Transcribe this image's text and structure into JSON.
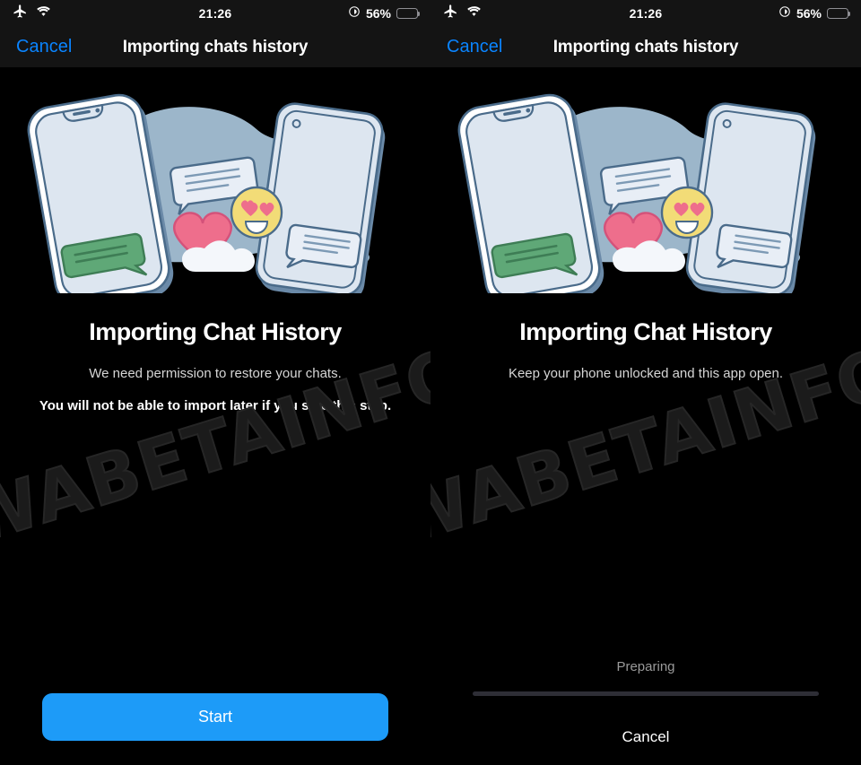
{
  "status_bar": {
    "airplane_icon": "airplane-icon",
    "wifi_icon": "wifi-icon",
    "time": "21:26",
    "focus_icon": "location-focus-icon",
    "battery_percent": "56%",
    "battery_level": 56
  },
  "nav": {
    "cancel_label": "Cancel",
    "title": "Importing chats history"
  },
  "watermark": {
    "text": "WABETAINFO"
  },
  "illustration": {
    "name": "chat-history-transfer-illustration",
    "blob_color": "#9cb6ca",
    "phone_body_color": "#dde6f0",
    "phone_outline_color": "#4a6b8a",
    "phone_shadow_color": "#6b8aa8",
    "heart_color": "#ee6e8c",
    "emoji_color": "#f2dc77",
    "cloud_color": "#f4f7fb",
    "green_bubble_color": "#5fa877",
    "light_bubble_color": "#e8eef6"
  },
  "panels": [
    {
      "id": "permission-screen",
      "heading": "Importing Chat History",
      "subtitle": "We need permission to restore your chats.",
      "warning": "You will not be able to import later if you skip this step.",
      "primary_button": "Start",
      "accent_color": "#1d9bf8"
    },
    {
      "id": "progress-screen",
      "heading": "Importing Chat History",
      "subtitle": "Keep your phone unlocked and this app open.",
      "progress_label": "Preparing",
      "progress_percent": 0,
      "cancel_button": "Cancel",
      "track_color": "#2e2e36"
    }
  ]
}
